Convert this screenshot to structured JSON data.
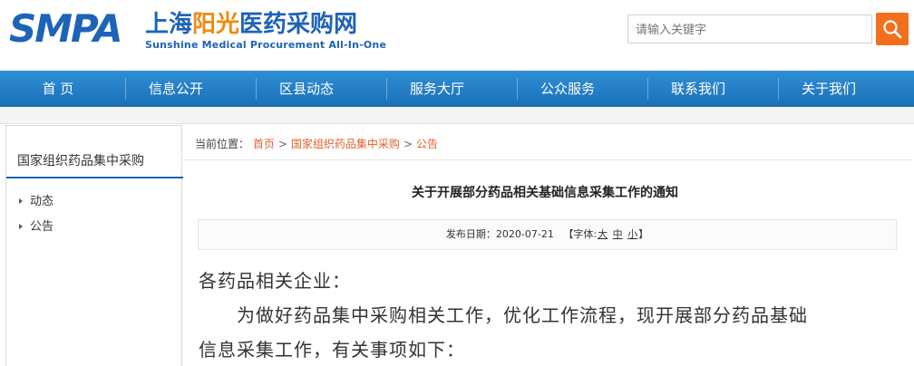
{
  "header": {
    "logo_text": "SMPA",
    "logo_cn_a": "上海",
    "logo_cn_b": "阳光",
    "logo_cn_c": "医药采购网",
    "logo_en": "Sunshine Medical Procurement All-In-One",
    "search_placeholder": "请输入关键字",
    "search_icon": "search-icon",
    "accent_color": "#f26f1d",
    "brand_color": "#1d63b8"
  },
  "nav": {
    "items": [
      {
        "label": "首 页"
      },
      {
        "label": "信息公开"
      },
      {
        "label": "区县动态"
      },
      {
        "label": "服务大厅"
      },
      {
        "label": "公众服务"
      },
      {
        "label": "联系我们"
      },
      {
        "label": "关于我们"
      }
    ]
  },
  "sidebar": {
    "title": "国家组织药品集中采购",
    "items": [
      {
        "label": "动态"
      },
      {
        "label": "公告"
      }
    ]
  },
  "breadcrumb": {
    "prefix": "当前位置：",
    "items": [
      "首页",
      "国家组织药品集中采购",
      "公告"
    ],
    "separator": ">"
  },
  "article": {
    "title": "关于开展部分药品相关基础信息采集工作的通知",
    "date_label": "发布日期：",
    "date": "2020-07-21",
    "font_label_open": "【字体:",
    "font_sizes": [
      "大",
      "中",
      "小"
    ],
    "font_label_close": "】",
    "paragraphs": [
      "各药品相关企业：",
      "　　为做好药品集中采购相关工作，优化工作流程，现开展部分药品基础",
      "信息采集工作，有关事项如下："
    ]
  }
}
